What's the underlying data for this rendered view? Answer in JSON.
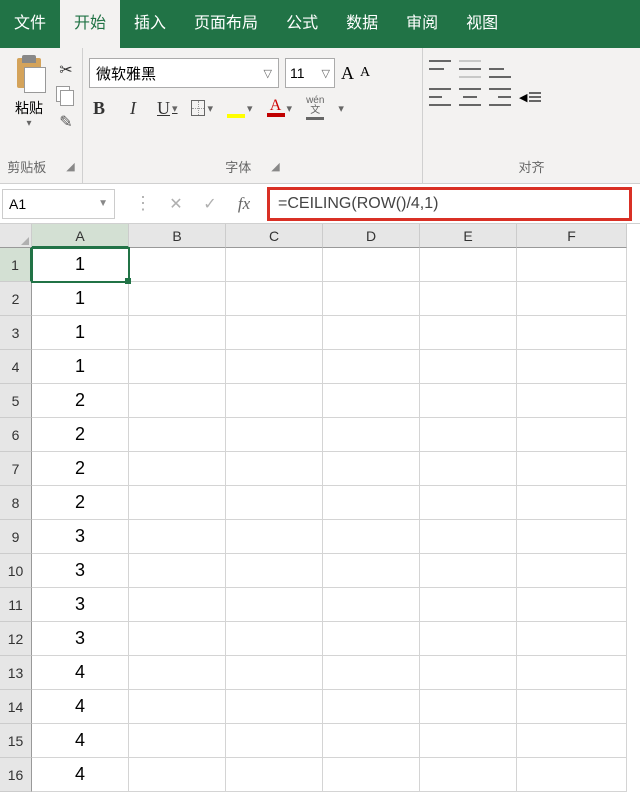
{
  "tabs": {
    "file": "文件",
    "home": "开始",
    "insert": "插入",
    "layout": "页面布局",
    "formulas": "公式",
    "data": "数据",
    "review": "审阅",
    "view": "视图"
  },
  "ribbon": {
    "clipboard": {
      "paste": "粘贴",
      "label": "剪贴板"
    },
    "font": {
      "name": "微软雅黑",
      "size": "11",
      "bold": "B",
      "italic": "I",
      "underline": "U",
      "wen_top": "wén",
      "wen_bot": "文",
      "fontcolor_a": "A",
      "aplus": "A",
      "aminus": "A",
      "label": "字体"
    },
    "align": {
      "label": "对齐"
    }
  },
  "namebox": "A1",
  "formula": "=CEILING(ROW()/4,1)",
  "fx_label": "fx",
  "columns": [
    "A",
    "B",
    "C",
    "D",
    "E",
    "F"
  ],
  "rows": [
    {
      "n": "1",
      "a": "1"
    },
    {
      "n": "2",
      "a": "1"
    },
    {
      "n": "3",
      "a": "1"
    },
    {
      "n": "4",
      "a": "1"
    },
    {
      "n": "5",
      "a": "2"
    },
    {
      "n": "6",
      "a": "2"
    },
    {
      "n": "7",
      "a": "2"
    },
    {
      "n": "8",
      "a": "2"
    },
    {
      "n": "9",
      "a": "3"
    },
    {
      "n": "10",
      "a": "3"
    },
    {
      "n": "11",
      "a": "3"
    },
    {
      "n": "12",
      "a": "3"
    },
    {
      "n": "13",
      "a": "4"
    },
    {
      "n": "14",
      "a": "4"
    },
    {
      "n": "15",
      "a": "4"
    },
    {
      "n": "16",
      "a": "4"
    }
  ],
  "chart_data": {
    "type": "table",
    "columns": [
      "A"
    ],
    "rows": [
      [
        1
      ],
      [
        1
      ],
      [
        1
      ],
      [
        1
      ],
      [
        2
      ],
      [
        2
      ],
      [
        2
      ],
      [
        2
      ],
      [
        3
      ],
      [
        3
      ],
      [
        3
      ],
      [
        3
      ],
      [
        4
      ],
      [
        4
      ],
      [
        4
      ],
      [
        4
      ]
    ],
    "formula": "=CEILING(ROW()/4,1)",
    "active_cell": "A1"
  }
}
